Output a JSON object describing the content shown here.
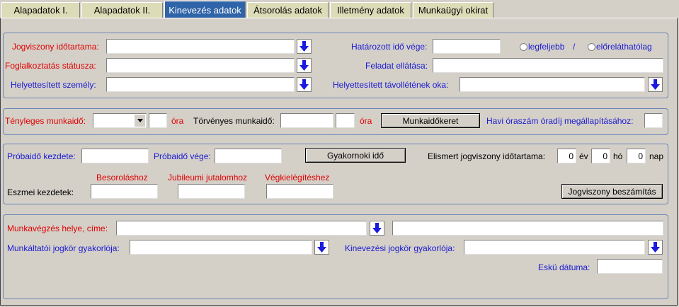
{
  "tabs": [
    {
      "label": "Alapadatok I.",
      "active": false
    },
    {
      "label": "Alapadatok II.",
      "active": false
    },
    {
      "label": "Kinevezés adatok",
      "active": true
    },
    {
      "label": "Átsorolás adatok",
      "active": false
    },
    {
      "label": "Illetmény adatok",
      "active": false
    },
    {
      "label": "Munkaügyi okirat",
      "active": false
    }
  ],
  "colors": {
    "active_tab": "#2f64a8",
    "inactive_tab": "#dcdcb8",
    "required_label": "#e00000",
    "optional_label": "#1a1ad0",
    "panel_border": "#6a86b8",
    "background": "#d4d0c8"
  },
  "section1": {
    "jogviszony_idotartama": "Jogviszony időtartama:",
    "hatarozott_ido_vege": "Határozott idő vége:",
    "radio_legfeljebb": "legfeljebb",
    "radio_separator": "/",
    "radio_eloreathatolag": "előreláthatólag",
    "foglalkoztatas_statusza": "Foglalkoztatás státusza:",
    "feladat_ellatasa": "Feladat ellátása:",
    "helyettesitett_szemely": "Helyettesített személy:",
    "helyettesitett_tavollet_oka": "Helyettesített távollétének oka:"
  },
  "section2": {
    "tenyleges_munkaido": "Tényleges munkaidő:",
    "ora1": "óra",
    "torvenyes_munkaido": "Törvényes munkaidő:",
    "ora2": "óra",
    "munkaidokeret_button": "Munkaidőkeret",
    "havi_oraszam": "Havi óraszám óradíj megállapításához:"
  },
  "section3": {
    "probaido_kezdete": "Próbaidő kezdete:",
    "probaido_vege": "Próbaidő vége:",
    "gyakornoki_ido_button": "Gyakornoki idő",
    "elismert_jogviszony": "Elismert jogviszony időtartama:",
    "ev_value": "0",
    "ev": "év",
    "ho_value": "0",
    "ho": "hó",
    "nap_value": "0",
    "nap": "nap",
    "besorolashoz": "Besoroláshoz",
    "jubileumi": "Jubileumi jutalomhoz",
    "vegkielegiteshez": "Végkielégítéshez",
    "eszmei_kezdetek": "Eszmei kezdetek:",
    "jogviszony_beszamitas_button": "Jogviszony beszámítás"
  },
  "section4": {
    "munkavegzes_helye": "Munkavégzés helye, címe:",
    "munkaltatoi_jogkor": "Munkáltatói jogkör gyakorlója:",
    "kinevezesi_jogkor": "Kinevezési jogkör gyakorlója:",
    "eskü_datuma": "Eskü dátuma:"
  },
  "icons": {
    "dropdown": "arrow-down-icon",
    "combo": "chevron-down-icon",
    "radio": "radio-icon"
  }
}
